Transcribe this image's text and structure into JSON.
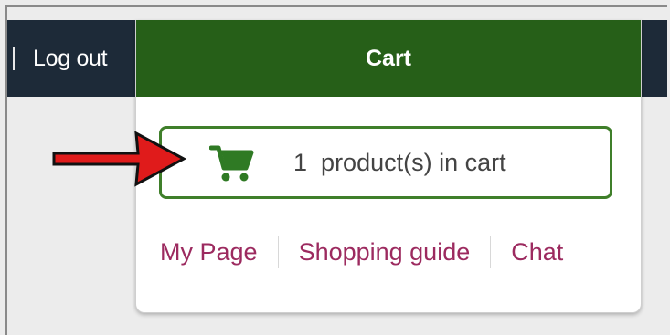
{
  "header": {
    "logout_label": "Log out"
  },
  "dropdown": {
    "title": "Cart",
    "cart_summary": {
      "count": "1",
      "label": "product(s) in cart"
    },
    "links": [
      {
        "label": "My Page"
      },
      {
        "label": "Shopping guide"
      },
      {
        "label": "Chat"
      }
    ]
  },
  "icons": {
    "cart": "shopping-cart-icon",
    "arrow": "red-arrow-icon"
  },
  "colors": {
    "topbar": "#1d2a38",
    "header_green": "#265f18",
    "cart_green": "#3f7f2a",
    "link": "#9c2a5f",
    "arrow_red": "#e01b1b"
  }
}
